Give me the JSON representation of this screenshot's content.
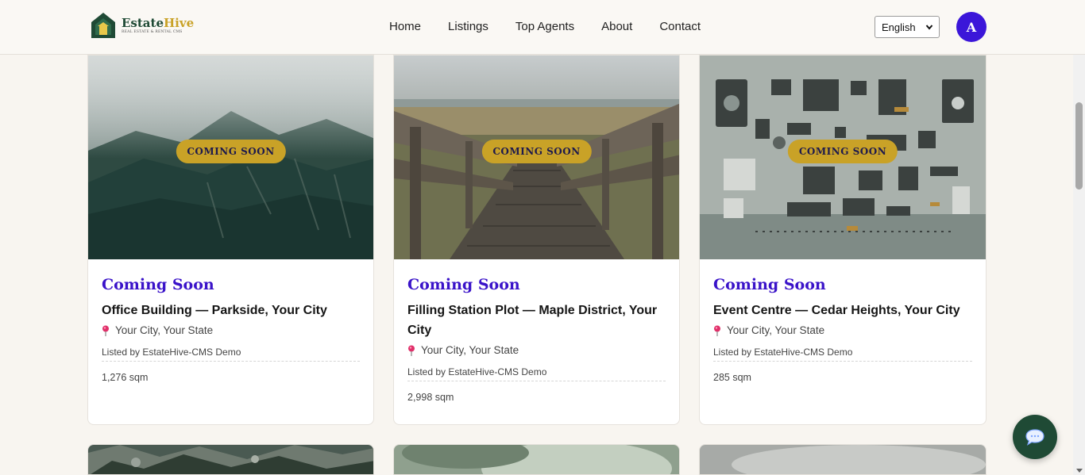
{
  "brand": {
    "name_part1": "Estate",
    "name_part2": "Hive",
    "tagline": "REAL ESTATE & RENTAL CMS"
  },
  "nav": {
    "items": [
      {
        "label": "Home"
      },
      {
        "label": "Listings"
      },
      {
        "label": "Top Agents"
      },
      {
        "label": "About"
      },
      {
        "label": "Contact"
      }
    ]
  },
  "language": {
    "selected": "English"
  },
  "user": {
    "initial": "A"
  },
  "cards": [
    {
      "badge": "COMING SOON",
      "status": "Coming Soon",
      "title": "Office Building — Parkside, Your City",
      "location": "Your City, Your State",
      "agent": "Listed by EstateHive-CMS Demo",
      "area": "1,276 sqm"
    },
    {
      "badge": "COMING SOON",
      "status": "Coming Soon",
      "title": "Filling Station Plot — Maple District, Your City",
      "location": "Your City, Your State",
      "agent": "Listed by EstateHive-CMS Demo",
      "area": "2,998 sqm"
    },
    {
      "badge": "COMING SOON",
      "status": "Coming Soon",
      "title": "Event Centre — Cedar Heights, Your City",
      "location": "Your City, Your State",
      "agent": "Listed by EstateHive-CMS Demo",
      "area": "285 sqm"
    }
  ],
  "icons": {
    "pin": "map-pin-icon",
    "chat": "chat-bubble-icon",
    "logo": "house-logo-icon"
  },
  "colors": {
    "brand_green": "#1f4a35",
    "brand_gold": "#c9a227",
    "accent_purple": "#3a13c9",
    "avatar": "#3b16d9"
  }
}
